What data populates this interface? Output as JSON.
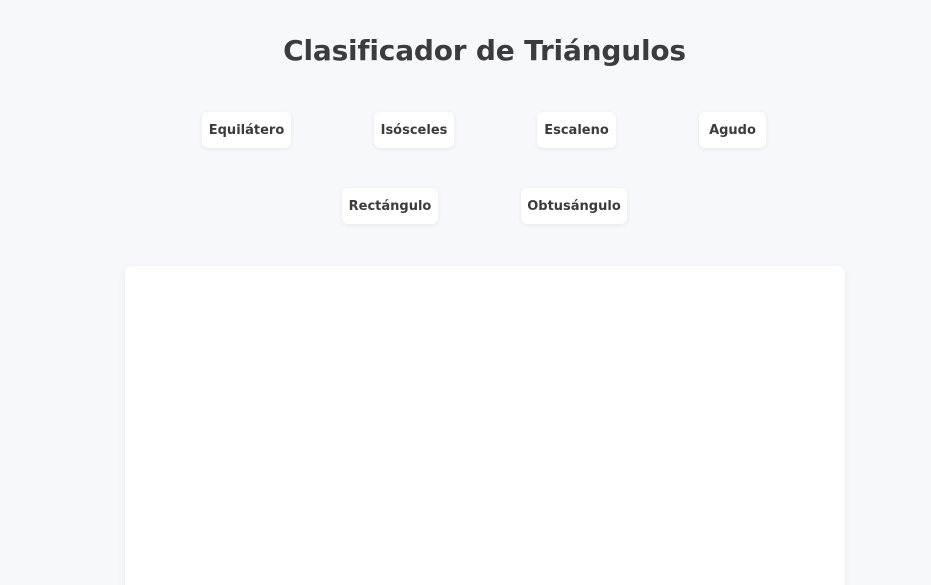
{
  "header": {
    "title": "Clasificador de Triángulos"
  },
  "buttons": [
    {
      "label": "Equilátero"
    },
    {
      "label": "Isósceles"
    },
    {
      "label": "Escaleno"
    },
    {
      "label": "Agudo"
    },
    {
      "label": "Rectángulo"
    },
    {
      "label": "Obtusángulo"
    }
  ],
  "colors": {
    "background": "#f7f8fb",
    "card": "#ffffff",
    "text": "#3c3c3c"
  }
}
